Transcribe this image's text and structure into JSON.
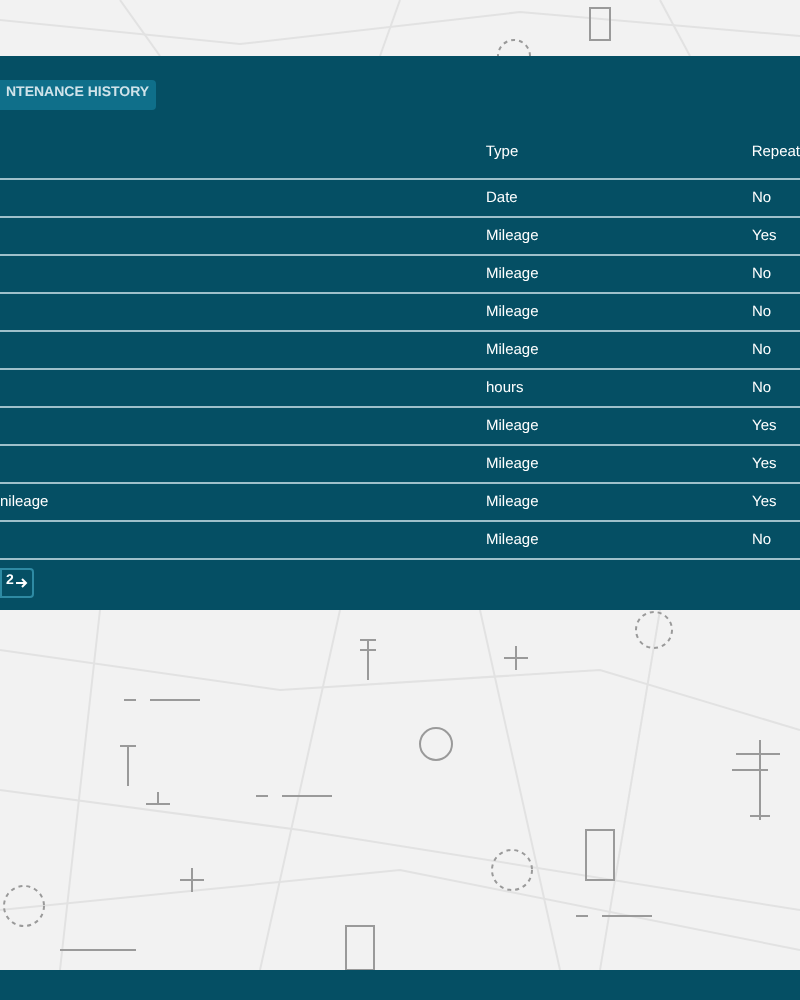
{
  "history_button": {
    "label": "NTENANCE HISTORY"
  },
  "table": {
    "columns": [
      "Type",
      "Repeat"
    ],
    "rows": [
      {
        "column_1": "",
        "type": "Date",
        "repeat": "No"
      },
      {
        "column_1": "",
        "type": "Mileage",
        "repeat": "Yes"
      },
      {
        "column_1": "",
        "type": "Mileage",
        "repeat": "No"
      },
      {
        "column_1": "",
        "type": "Mileage",
        "repeat": "No"
      },
      {
        "column_1": "",
        "type": "Mileage",
        "repeat": "No"
      },
      {
        "column_1": "",
        "type": "hours",
        "repeat": "No"
      },
      {
        "column_1": "",
        "type": "Mileage",
        "repeat": "Yes"
      },
      {
        "column_1": "",
        "type": "Mileage",
        "repeat": "Yes"
      },
      {
        "column_1": "nileage",
        "type": "Mileage",
        "repeat": "Yes"
      },
      {
        "column_1": "",
        "type": "Mileage",
        "repeat": "No"
      }
    ]
  },
  "pagination": {
    "page": "2"
  }
}
